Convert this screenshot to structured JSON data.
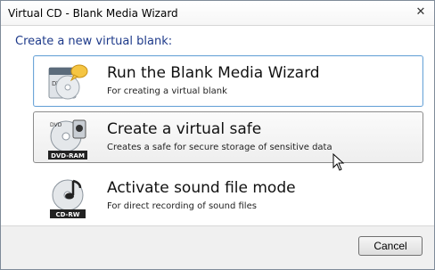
{
  "window": {
    "title": "Virtual CD - Blank Media Wizard",
    "close_glyph": "✕"
  },
  "heading": "Create a new virtual blank:",
  "options": [
    {
      "label": "Run the Blank Media Wizard",
      "description": "For creating a virtual blank",
      "icon": "dvd-wizard-icon",
      "badge": ""
    },
    {
      "label": "Create a virtual safe",
      "description": "Creates a safe for secure storage of sensitive data",
      "icon": "dvd-ram-safe-icon",
      "badge": "DVD-RAM"
    },
    {
      "label": "Activate sound file mode",
      "description": "For direct recording of sound files",
      "icon": "cd-rw-sound-icon",
      "badge": "CD-RW"
    }
  ],
  "footer": {
    "cancel_label": "Cancel"
  },
  "colors": {
    "heading": "#1e3a8a",
    "focus_border": "#6fa7d8",
    "hover_border": "#8c8c8c"
  }
}
